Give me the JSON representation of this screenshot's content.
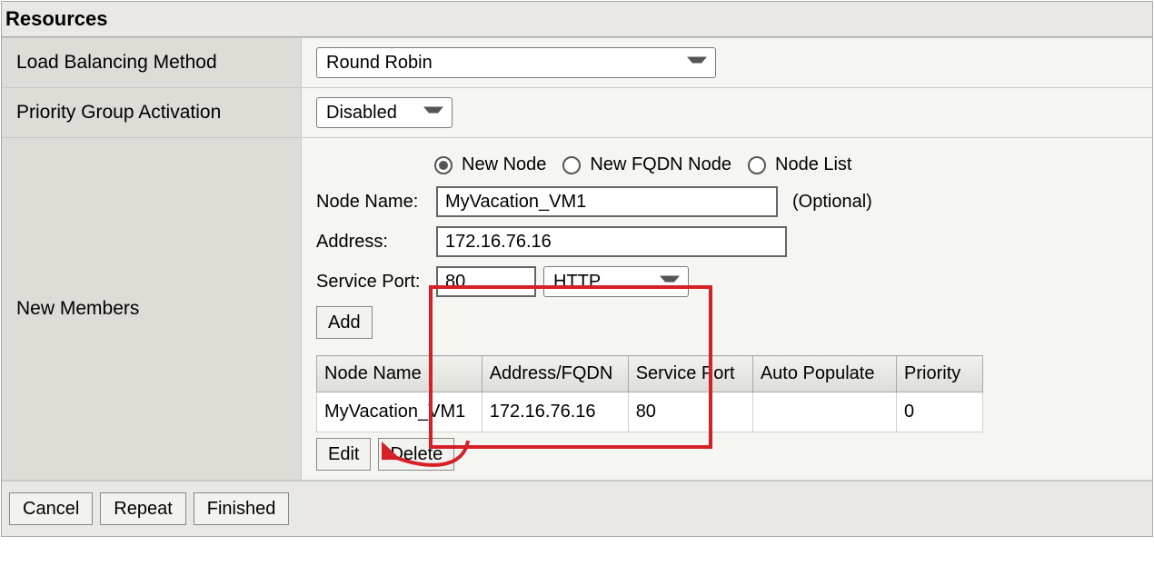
{
  "section_title": "Resources",
  "fields": {
    "lb_method": {
      "label": "Load Balancing Method",
      "value": "Round Robin"
    },
    "priority_group": {
      "label": "Priority Group Activation",
      "value": "Disabled"
    },
    "new_members_label": "New Members"
  },
  "new_member_form": {
    "radios": {
      "new_node": "New Node",
      "new_fqdn_node": "New FQDN Node",
      "node_list": "Node List",
      "selected": "new_node"
    },
    "node_name": {
      "label": "Node Name:",
      "value": "MyVacation_VM1",
      "optional_text": "(Optional)"
    },
    "address": {
      "label": "Address:",
      "value": "172.16.76.16"
    },
    "service_port": {
      "label": "Service Port:",
      "value": "80",
      "protocol": "HTTP"
    },
    "add_button": "Add"
  },
  "members_table": {
    "headers": {
      "node_name": "Node Name",
      "address_fqdn": "Address/FQDN",
      "service_port": "Service Port",
      "auto_populate": "Auto Populate",
      "priority": "Priority"
    },
    "rows": [
      {
        "node_name": "MyVacation_VM1",
        "address_fqdn": "172.16.76.16",
        "service_port": "80",
        "auto_populate": "",
        "priority": "0"
      }
    ],
    "edit_button": "Edit",
    "delete_button": "Delete"
  },
  "footer": {
    "cancel": "Cancel",
    "repeat": "Repeat",
    "finished": "Finished"
  },
  "annotation": {
    "highlight": "red-box",
    "arrow": "curved-arrow-to-add"
  }
}
